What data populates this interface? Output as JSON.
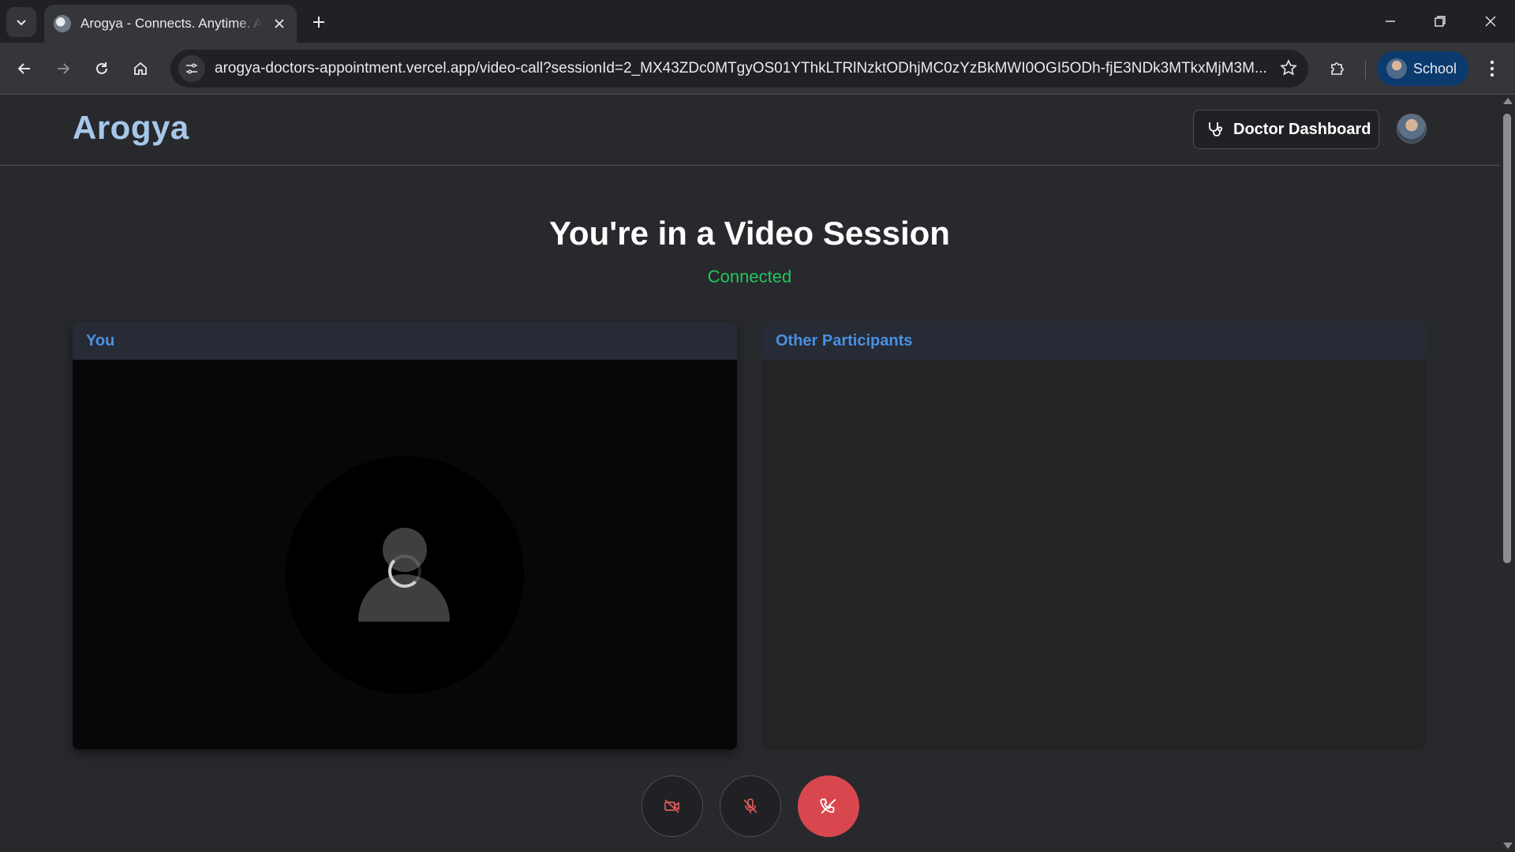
{
  "browser": {
    "tab": {
      "title": "Arogya - Connects. Anytime. Anywhere"
    },
    "address_bar": {
      "url": "arogya-doctors-appointment.vercel.app/video-call?sessionId=2_MX43ZDc0MTgyOS01YThkLTRlNzktODhjMC0zYzBkMWI0OGI5ODh-fjE3NDk3MTkxMjM3M..."
    },
    "profile": {
      "label": "School"
    }
  },
  "header": {
    "brand": "Arogya",
    "dashboard_button": "Doctor Dashboard"
  },
  "session": {
    "title": "You're in a Video Session",
    "status": "Connected",
    "status_color": "#22c55e"
  },
  "panels": {
    "local": {
      "label": "You"
    },
    "remote": {
      "label": "Other Participants"
    }
  },
  "controls": {
    "camera": {
      "icon": "video-off-icon",
      "state": "off"
    },
    "microphone": {
      "icon": "mic-off-icon",
      "state": "off"
    },
    "end_call": {
      "icon": "phone-off-icon",
      "color": "#d9474e"
    }
  },
  "colors": {
    "accent": "#4a90e2",
    "brand": "#a6c7ea"
  }
}
